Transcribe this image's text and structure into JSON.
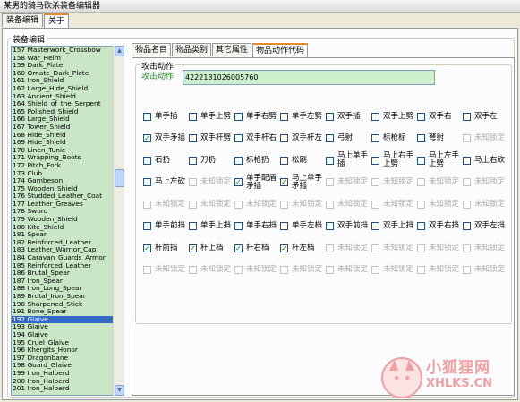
{
  "window": {
    "title": "某男的骑马砍杀装备编辑器"
  },
  "top_tabs": [
    {
      "label": "装备编辑"
    },
    {
      "label": "关于"
    }
  ],
  "left": {
    "group_label": "装备编辑",
    "items": [
      "157 Masterwork_Crossbow",
      "158 War_Helm",
      "159 Dark_Plate",
      "160 Ornate_Dark_Plate",
      "161 Iron_Shield",
      "162 Large_Hide_Shield",
      "163 Ancient_Shield",
      "164 Shield_of_the_Serpent",
      "165 Polished_Shield",
      "166 Large_Shield",
      "167 Tower_Shield",
      "168 Hide_Shield",
      "169 Hide_Shield",
      "170 Linen_Tunic",
      "171 Wrapping_Boots",
      "172 Pitch_Fork",
      "173 Club",
      "174 Gambeson",
      "175 Wooden_Shield",
      "176 Studded_Leather_Coat",
      "177 Leather_Greaves",
      "178 Sword",
      "179 Wooden_Shield",
      "180 Kite_Shield",
      "181 Spear",
      "182 Reinforced_Leather",
      "183 Leather_Warrior_Cap",
      "184 Caravan_Guards_Armor",
      "185 Reinforced_Leather",
      "186 Brutal_Spear",
      "187 Iron_Spear",
      "188 Iron_Long_Spear",
      "189 Brutal_Iron_Spear",
      "190 Sharpened_Stick",
      "191 Bone_Spear",
      "192 Glaive",
      "193 Glaive",
      "194 Glaive",
      "195 Cruel_Glaive",
      "196 Khergits_Honor",
      "197 Dragonbane",
      "198 Guard_Glaive",
      "199 Iron_Halberd",
      "200 Iron_Halberd",
      "201 Iron_Halberd"
    ],
    "selected_index": 35
  },
  "sub_tabs": [
    {
      "label": "物品名目"
    },
    {
      "label": "物品类别"
    },
    {
      "label": "其它属性"
    },
    {
      "label": "物品动作代码"
    }
  ],
  "attack": {
    "group_label": "攻击动作",
    "field_label": "攻击动作",
    "code_value": "4222131026005760"
  },
  "checkboxes": [
    {
      "label": "单手插",
      "checked": false,
      "disabled": false
    },
    {
      "label": "单手上劈",
      "checked": false,
      "disabled": false
    },
    {
      "label": "单手右劈",
      "checked": false,
      "disabled": false
    },
    {
      "label": "单手左劈",
      "checked": false,
      "disabled": false
    },
    {
      "label": "双手插",
      "checked": false,
      "disabled": false
    },
    {
      "label": "双手上劈",
      "checked": false,
      "disabled": false
    },
    {
      "label": "双手右",
      "checked": false,
      "disabled": false
    },
    {
      "label": "双手左",
      "checked": false,
      "disabled": false
    },
    {
      "label": "双手矛插",
      "checked": true,
      "disabled": false
    },
    {
      "label": "双手杆劈",
      "checked": false,
      "disabled": false
    },
    {
      "label": "双手杆右",
      "checked": false,
      "disabled": false
    },
    {
      "label": "双手杆左",
      "checked": false,
      "disabled": false
    },
    {
      "label": "弓射",
      "checked": false,
      "disabled": false
    },
    {
      "label": "标枪标",
      "checked": false,
      "disabled": false
    },
    {
      "label": "弩射",
      "checked": false,
      "disabled": false
    },
    {
      "label": "未知锁定",
      "checked": false,
      "disabled": true
    },
    {
      "label": "石扔",
      "checked": false,
      "disabled": false
    },
    {
      "label": "刀扔",
      "checked": false,
      "disabled": false
    },
    {
      "label": "标枪扔",
      "checked": false,
      "disabled": false
    },
    {
      "label": "松刷",
      "checked": false,
      "disabled": false
    },
    {
      "label": "马上单手插",
      "checked": false,
      "disabled": false
    },
    {
      "label": "马上右手上劈",
      "checked": false,
      "disabled": false
    },
    {
      "label": "马上左手上劈",
      "checked": false,
      "disabled": false
    },
    {
      "label": "马上右砍",
      "checked": false,
      "disabled": false
    },
    {
      "label": "马上左砍",
      "checked": false,
      "disabled": false
    },
    {
      "label": "未知锁定",
      "checked": false,
      "disabled": true
    },
    {
      "label": "单手配盾矛插",
      "checked": true,
      "disabled": false
    },
    {
      "label": "马上单手矛插",
      "checked": true,
      "disabled": false
    },
    {
      "label": "未知锁定",
      "checked": false,
      "disabled": true
    },
    {
      "label": "未知锁定",
      "checked": false,
      "disabled": true
    },
    {
      "label": "未知锁定",
      "checked": false,
      "disabled": true
    },
    {
      "label": "未知锁定",
      "checked": false,
      "disabled": true
    },
    {
      "label": "未知锁定",
      "checked": false,
      "disabled": true
    },
    {
      "label": "未知锁定",
      "checked": false,
      "disabled": true
    },
    {
      "label": "未知锁定",
      "checked": false,
      "disabled": true
    },
    {
      "label": "未知锁定",
      "checked": false,
      "disabled": true
    },
    {
      "label": "未知锁定",
      "checked": false,
      "disabled": true
    },
    {
      "label": "未知锁定",
      "checked": false,
      "disabled": true
    },
    {
      "label": "未知锁定",
      "checked": false,
      "disabled": true
    },
    {
      "label": "未知锁定",
      "checked": false,
      "disabled": true
    },
    {
      "label": "单手前挡",
      "checked": false,
      "disabled": false
    },
    {
      "label": "单手上挡",
      "checked": false,
      "disabled": false
    },
    {
      "label": "单手右挡",
      "checked": false,
      "disabled": false
    },
    {
      "label": "单手左档",
      "checked": false,
      "disabled": false
    },
    {
      "label": "双手前挡",
      "checked": false,
      "disabled": false
    },
    {
      "label": "双手上挡",
      "checked": false,
      "disabled": false
    },
    {
      "label": "双手右挡",
      "checked": false,
      "disabled": false
    },
    {
      "label": "双手左挡",
      "checked": false,
      "disabled": false
    },
    {
      "label": "杆前挡",
      "checked": true,
      "disabled": false
    },
    {
      "label": "杆上档",
      "checked": true,
      "disabled": false
    },
    {
      "label": "杆右档",
      "checked": true,
      "disabled": false
    },
    {
      "label": "杆左档",
      "checked": true,
      "disabled": false
    },
    {
      "label": "未知锁定",
      "checked": false,
      "disabled": true
    },
    {
      "label": "未知锁定",
      "checked": false,
      "disabled": true
    },
    {
      "label": "未知锁定",
      "checked": false,
      "disabled": true
    },
    {
      "label": "未知锁定",
      "checked": false,
      "disabled": true
    },
    {
      "label": "未知锁定",
      "checked": false,
      "disabled": true
    },
    {
      "label": "未知锁定",
      "checked": false,
      "disabled": true
    },
    {
      "label": "未知锁定",
      "checked": false,
      "disabled": true
    },
    {
      "label": "未知锁定",
      "checked": false,
      "disabled": true
    },
    {
      "label": "未知锁定",
      "checked": false,
      "disabled": true
    },
    {
      "label": "未知锁定",
      "checked": false,
      "disabled": true
    },
    {
      "label": "未知锁定",
      "checked": false,
      "disabled": true
    },
    {
      "label": "未知锁定",
      "checked": false,
      "disabled": true
    }
  ],
  "watermark": {
    "text": "小狐狸网",
    "url": "XHLKS.CN"
  }
}
